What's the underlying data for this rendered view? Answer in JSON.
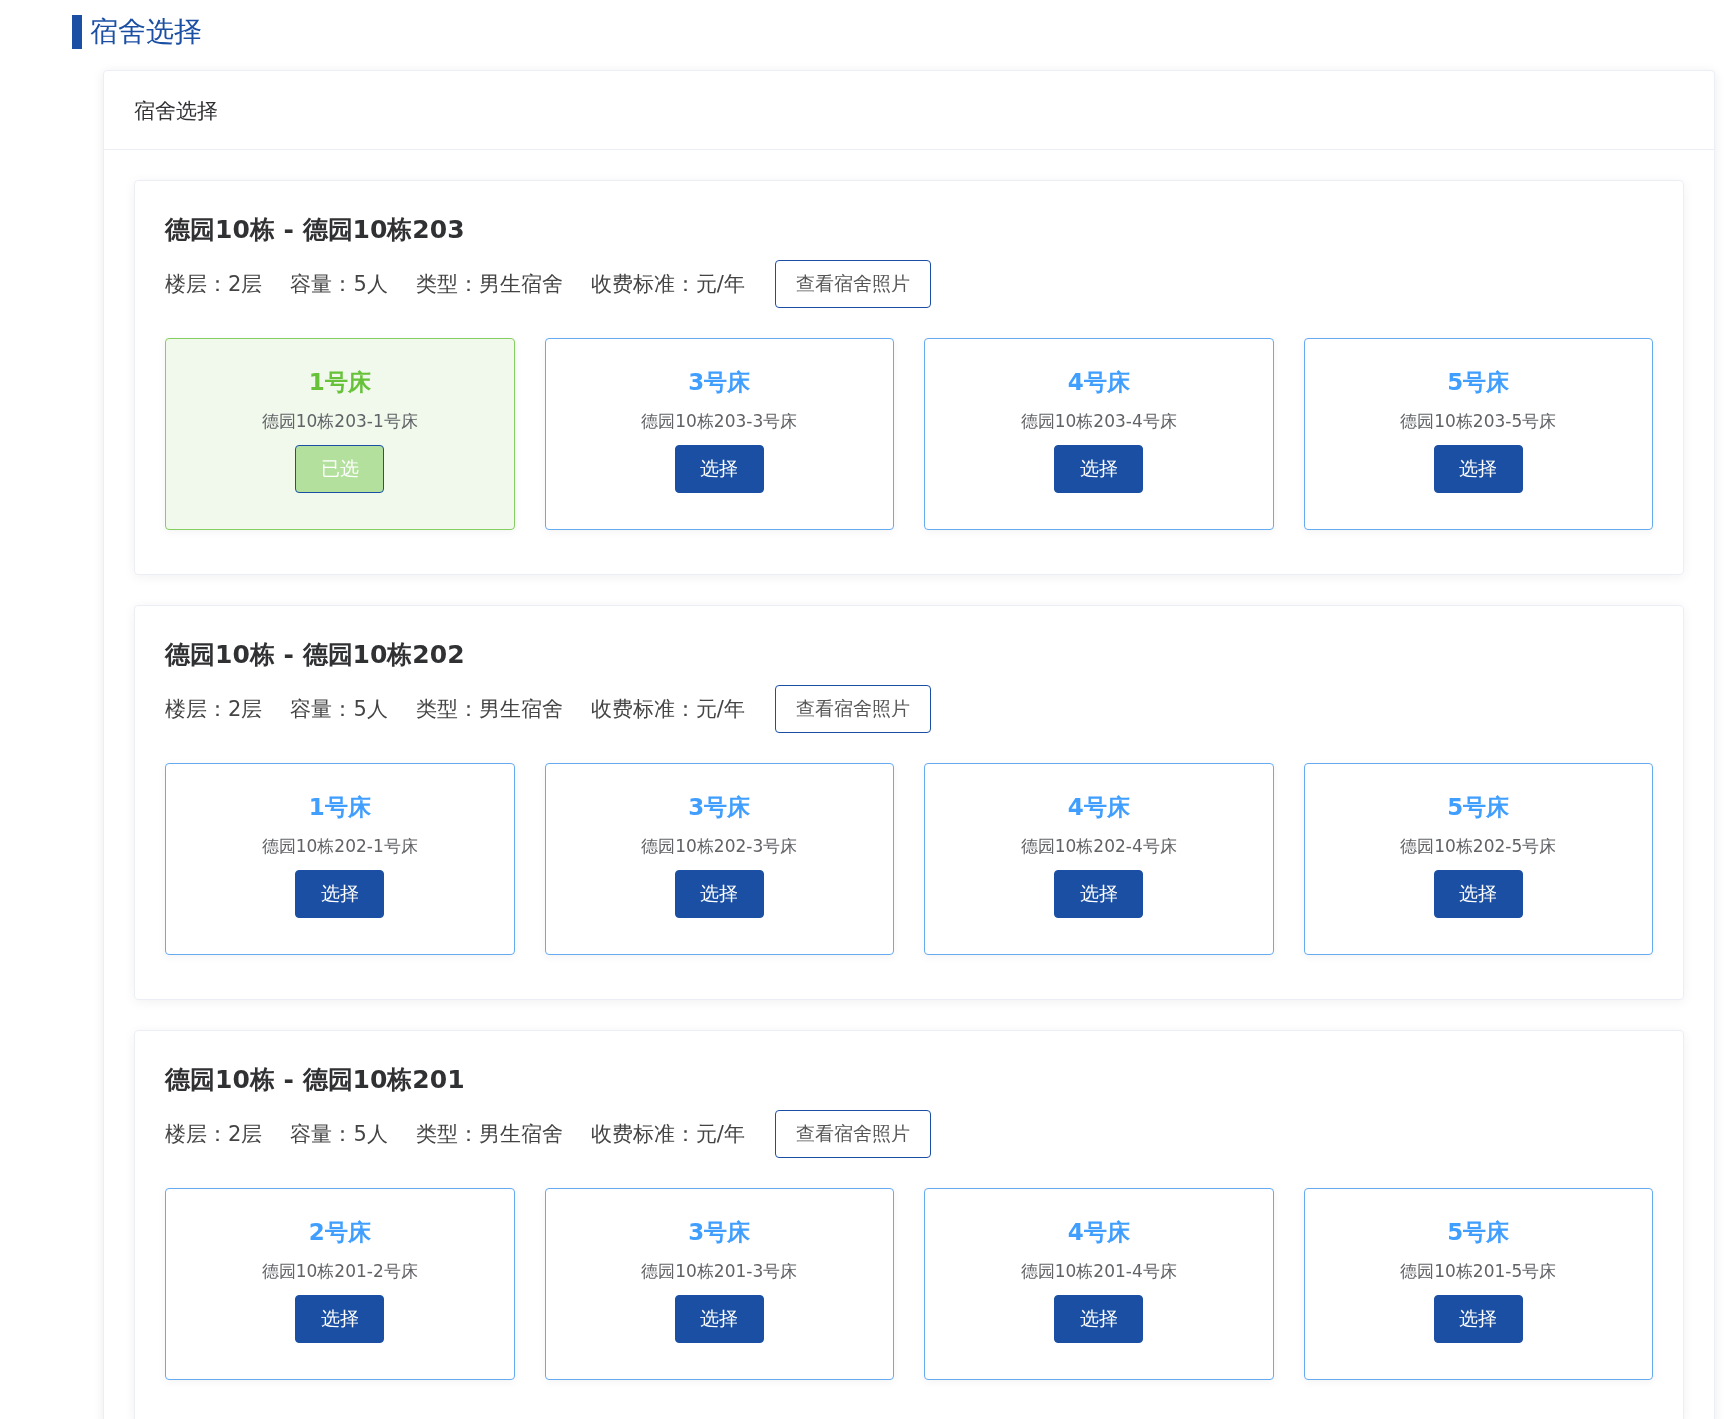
{
  "page_title": "宿舍选择",
  "panel": {
    "title": "宿舍选择",
    "rooms": [
      {
        "title": "德园10栋 - 德园10栋203",
        "floor": "楼层：2层",
        "capacity": "容量：5人",
        "type": "类型：男生宿舍",
        "fee": "收费标准：元/年",
        "photo_button": "查看宿舍照片",
        "beds": [
          {
            "name": "1号床",
            "label": "德园10栋203-1号床",
            "button": "已选",
            "selected": true
          },
          {
            "name": "3号床",
            "label": "德园10栋203-3号床",
            "button": "选择",
            "selected": false
          },
          {
            "name": "4号床",
            "label": "德园10栋203-4号床",
            "button": "选择",
            "selected": false
          },
          {
            "name": "5号床",
            "label": "德园10栋203-5号床",
            "button": "选择",
            "selected": false
          }
        ]
      },
      {
        "title": "德园10栋 - 德园10栋202",
        "floor": "楼层：2层",
        "capacity": "容量：5人",
        "type": "类型：男生宿舍",
        "fee": "收费标准：元/年",
        "photo_button": "查看宿舍照片",
        "beds": [
          {
            "name": "1号床",
            "label": "德园10栋202-1号床",
            "button": "选择",
            "selected": false
          },
          {
            "name": "3号床",
            "label": "德园10栋202-3号床",
            "button": "选择",
            "selected": false
          },
          {
            "name": "4号床",
            "label": "德园10栋202-4号床",
            "button": "选择",
            "selected": false
          },
          {
            "name": "5号床",
            "label": "德园10栋202-5号床",
            "button": "选择",
            "selected": false
          }
        ]
      },
      {
        "title": "德园10栋 - 德园10栋201",
        "floor": "楼层：2层",
        "capacity": "容量：5人",
        "type": "类型：男生宿舍",
        "fee": "收费标准：元/年",
        "photo_button": "查看宿舍照片",
        "beds": [
          {
            "name": "2号床",
            "label": "德园10栋201-2号床",
            "button": "选择",
            "selected": false
          },
          {
            "name": "3号床",
            "label": "德园10栋201-3号床",
            "button": "选择",
            "selected": false
          },
          {
            "name": "4号床",
            "label": "德园10栋201-4号床",
            "button": "选择",
            "selected": false
          },
          {
            "name": "5号床",
            "label": "德园10栋201-5号床",
            "button": "选择",
            "selected": false
          }
        ]
      }
    ]
  }
}
